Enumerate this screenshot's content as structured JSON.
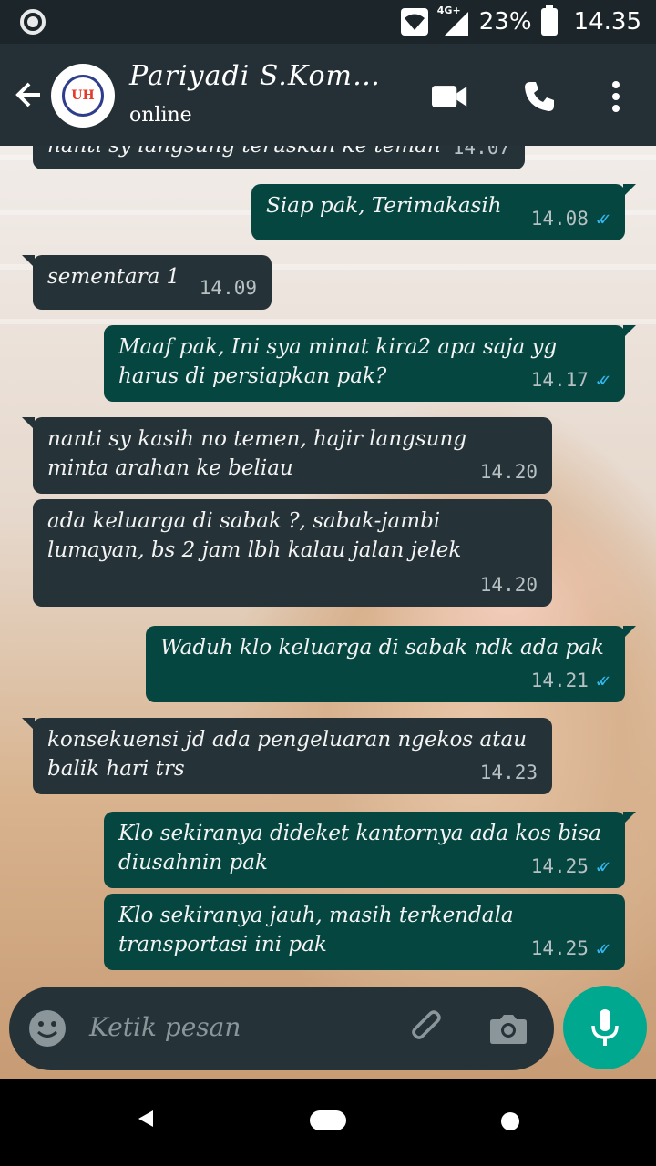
{
  "status_bar": {
    "network": "4G+",
    "battery": "23%",
    "time": "14.35"
  },
  "header": {
    "contact_name": "Pariyadi S.Kom…",
    "contact_status": "online",
    "avatar_text": "UH"
  },
  "messages": [
    {
      "dir": "in",
      "text": "nanti sy langsung teruskan ke teman",
      "time": "14.07",
      "partial": true
    },
    {
      "dir": "out",
      "text": "Siap pak, Terimakasih",
      "time": "14.08",
      "read": true
    },
    {
      "dir": "in",
      "text": "sementara 1",
      "time": "14.09"
    },
    {
      "dir": "out",
      "text": "Maaf pak, Ini sya minat kira2 apa saja yg harus di persiapkan pak?",
      "time": "14.17",
      "read": true
    },
    {
      "dir": "in",
      "text": "nanti sy kasih no temen, hajir langsung minta arahan ke beliau",
      "time": "14.20"
    },
    {
      "dir": "in",
      "text": "ada keluarga di sabak ?, sabak-jambi lumayan, bs 2 jam lbh kalau jalan jelek",
      "time": "14.20"
    },
    {
      "dir": "out",
      "text": "Waduh klo keluarga di sabak ndk ada pak",
      "time": "14.21",
      "read": true
    },
    {
      "dir": "in",
      "text": "konsekuensi jd ada pengeluaran ngekos atau balik hari trs",
      "time": "14.23"
    },
    {
      "dir": "out",
      "text": "Klo sekiranya dideket kantornya ada kos bisa diusahnin pak",
      "time": "14.25",
      "read": true
    },
    {
      "dir": "out",
      "text": "Klo sekiranya jauh, masih terkendala transportasi ini pak",
      "time": "14.25",
      "read": true
    }
  ],
  "composer": {
    "placeholder": "Ketik pesan"
  },
  "icons": {
    "back": "arrow-left-icon",
    "video": "video-call-icon",
    "call": "phone-icon",
    "menu": "more-vert-icon",
    "emoji": "emoji-icon",
    "attach": "paperclip-icon",
    "camera": "camera-icon",
    "mic": "microphone-icon"
  },
  "colors": {
    "toolbar": "#253036",
    "incoming_bubble": "#253238",
    "outgoing_bubble": "#054740",
    "read_ticks": "#34b7f1",
    "mic_button": "#00a88f"
  }
}
